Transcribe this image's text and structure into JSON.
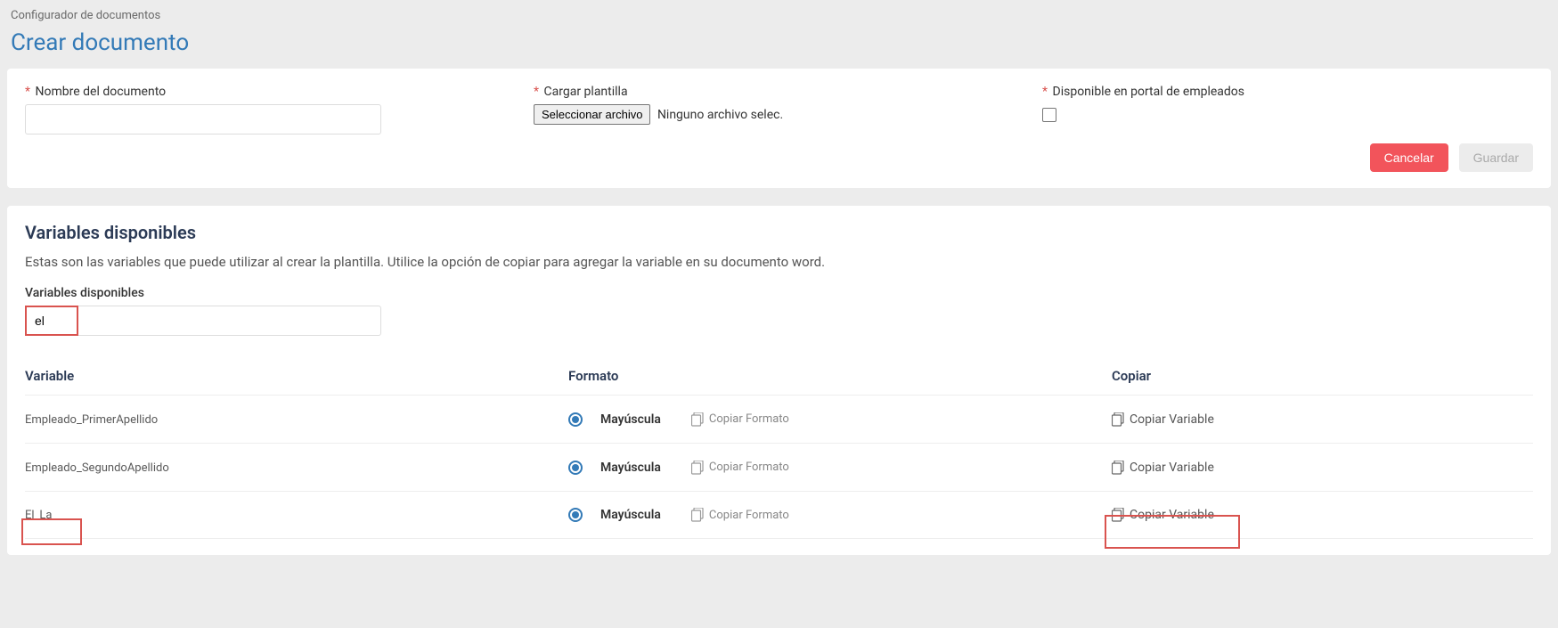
{
  "breadcrumb": "Configurador de documentos",
  "page_title": "Crear documento",
  "form": {
    "name_label": "Nombre del documento",
    "name_value": "",
    "template_label": "Cargar plantilla",
    "file_button": "Seleccionar archivo",
    "file_status": "Ninguno archivo selec.",
    "portal_label": "Disponible en portal de empleados",
    "cancel": "Cancelar",
    "save": "Guardar"
  },
  "vars": {
    "title": "Variables disponibles",
    "desc": "Estas son las variables que puede utilizar al crear la plantilla. Utilice la opción de copiar para agregar la variable en su documento word.",
    "filter_label": "Variables disponibles",
    "filter_value": "el",
    "col_variable": "Variable",
    "col_formato": "Formato",
    "col_copiar": "Copiar",
    "format_option": "Mayúscula",
    "copy_format": "Copiar Formato",
    "copy_variable": "Copiar Variable",
    "rows": [
      {
        "name": "Empleado_PrimerApellido"
      },
      {
        "name": "Empleado_SegundoApellido"
      },
      {
        "name": "El_La"
      }
    ]
  }
}
